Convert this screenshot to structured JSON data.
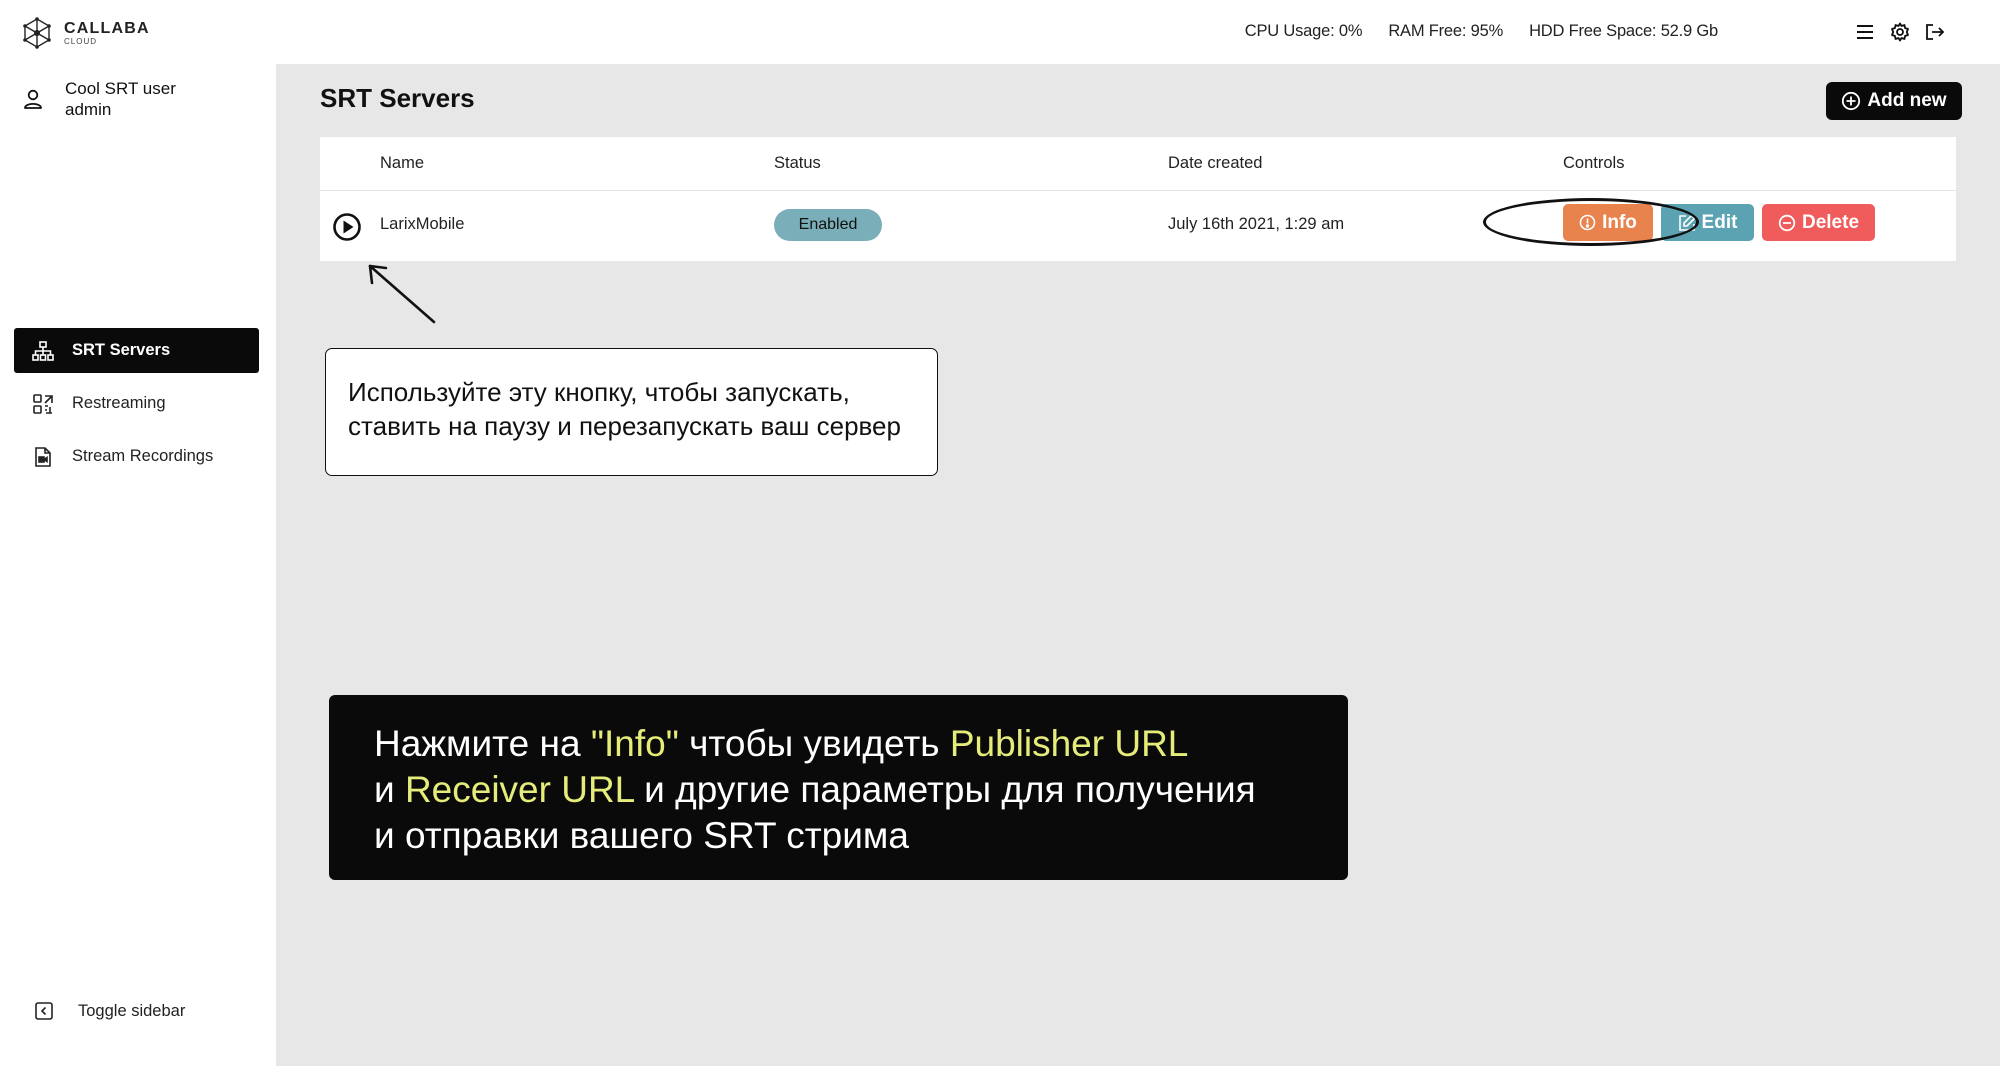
{
  "brand": {
    "title": "CALLABA",
    "subtitle": "CLOUD"
  },
  "user": {
    "name": "Cool SRT user",
    "role": "admin"
  },
  "sidebar": {
    "items": [
      {
        "label": "SRT Servers",
        "icon": "network-icon",
        "active": true
      },
      {
        "label": "Restreaming",
        "icon": "restream-icon",
        "active": false
      },
      {
        "label": "Stream Recordings",
        "icon": "document-icon",
        "active": false
      }
    ],
    "toggle_label": "Toggle sidebar"
  },
  "topbar": {
    "cpu": "CPU Usage: 0%",
    "ram": "RAM Free: 95%",
    "hdd": "HDD Free Space: 52.9 Gb",
    "icons": [
      "menu-icon",
      "gear-icon",
      "logout-icon"
    ]
  },
  "page": {
    "title": "SRT Servers",
    "add_new_label": "Add new"
  },
  "table": {
    "headers": {
      "name": "Name",
      "status": "Status",
      "date": "Date created",
      "controls": "Controls"
    },
    "rows": [
      {
        "name": "LarixMobile",
        "status": "Enabled",
        "date": "July 16th 2021, 1:29 am",
        "info_label": "Info",
        "edit_label": "Edit",
        "delete_label": "Delete"
      }
    ]
  },
  "callouts": {
    "play": {
      "line1": "Используйте эту кнопку, чтобы запускать,",
      "line2": "ставить на паузу и перезапускать ваш сервер"
    },
    "info": {
      "l1_a": "Нажмите на ",
      "l1_b": "\"Info\"",
      "l1_c": " чтобы увидеть ",
      "l1_d": "Publisher URL",
      "l2_a": "и ",
      "l2_b": "Receiver URL",
      "l2_c": " и другие параметры для получения",
      "l3": "и отправки вашего SRT стрима"
    }
  },
  "colors": {
    "accent_dark": "#0a0a0a",
    "status_enabled": "#7aaeb8",
    "info": "#e9834d",
    "edit": "#5ba3b2",
    "delete": "#f05b5b",
    "highlight": "#e6ec7a",
    "content_bg": "#e7e7e7"
  }
}
